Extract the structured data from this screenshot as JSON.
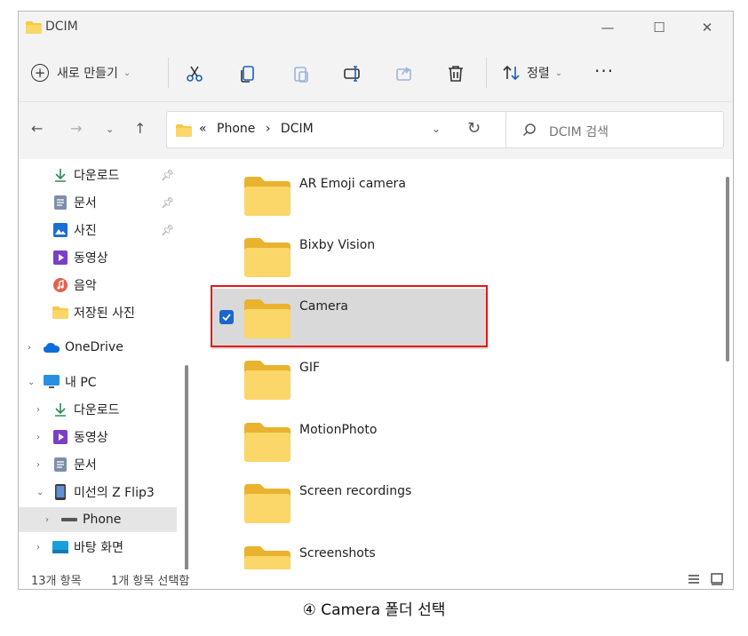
{
  "window": {
    "title": "DCIM",
    "controls": {
      "minimize": "—",
      "maximize": "☐",
      "close": "✕"
    }
  },
  "toolbar": {
    "new_label": "새로 만들기",
    "sort_label": "정렬",
    "more_label": "···",
    "tools": [
      "cut-icon",
      "copy-icon",
      "paste-icon",
      "rename-icon",
      "share-icon",
      "delete-icon"
    ]
  },
  "address": {
    "prefix": "«",
    "segments": [
      "Phone",
      "DCIM"
    ],
    "separator": "›",
    "search_placeholder": "DCIM 검색"
  },
  "sidebar": {
    "items": [
      {
        "label": "다운로드",
        "icon": "download-icon",
        "pinned": true
      },
      {
        "label": "문서",
        "icon": "document-icon",
        "pinned": true
      },
      {
        "label": "사진",
        "icon": "pictures-icon",
        "pinned": true
      },
      {
        "label": "동영상",
        "icon": "video-icon",
        "pinned": false
      },
      {
        "label": "음악",
        "icon": "music-icon",
        "pinned": false
      },
      {
        "label": "저장된 사진",
        "icon": "folder-icon",
        "pinned": false
      },
      {
        "label": "OneDrive",
        "icon": "cloud-icon",
        "expander": "›"
      },
      {
        "label": "내 PC",
        "icon": "pc-icon",
        "expander": "⌄"
      },
      {
        "label": "다운로드",
        "icon": "download-icon",
        "expander": "›"
      },
      {
        "label": "동영상",
        "icon": "video-icon",
        "expander": "›"
      },
      {
        "label": "문서",
        "icon": "document-icon",
        "expander": "›"
      },
      {
        "label": "미선의 Z Flip3",
        "icon": "phone-icon",
        "expander": "⌄"
      },
      {
        "label": "Phone",
        "icon": "drive-icon",
        "expander": "›",
        "selected": true
      },
      {
        "label": "바탕 화면",
        "icon": "desktop-icon",
        "expander": "›"
      }
    ]
  },
  "files": [
    {
      "name": "AR Emoji camera"
    },
    {
      "name": "Bixby Vision"
    },
    {
      "name": "Camera",
      "selected": true
    },
    {
      "name": "GIF"
    },
    {
      "name": "MotionPhoto"
    },
    {
      "name": "Screen recordings"
    },
    {
      "name": "Screenshots"
    }
  ],
  "status": {
    "count": "13개 항목",
    "selection": "1개 항목 선택함"
  },
  "caption": "④ Camera 폴더 선택",
  "colors": {
    "folder": "#f7c948",
    "folder_dark": "#e9b22f",
    "selection_border": "#e31818",
    "checkbox": "#1b66c9"
  }
}
